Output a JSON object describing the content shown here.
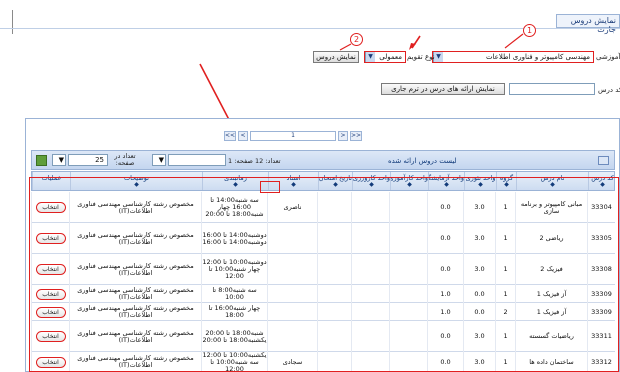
{
  "top": {
    "tab_label": "نمایش دروس جارت",
    "group_label": "گروه آموزشی",
    "group_value": "مهندسی کامپیوتر و فناوری اطلاعات",
    "type_label": "نوع تقویم",
    "type_value": "معمولی",
    "show_button": "نمایش دروس",
    "course_label": "کد درس",
    "offered_button": "نمایش ارائه های درس در ترم جاری",
    "marker_1": "1",
    "marker_2": "2"
  },
  "pager": {
    "first": "<<",
    "prev": "<",
    "current": "1",
    "next": ">",
    "last": ">>"
  },
  "table": {
    "title": "لیست دروس ارائه شده",
    "count_label": "تعداد: 12 صفحه: 1",
    "per_page_label": "تعداد در صفحه:",
    "per_page_value": "25",
    "columns": [
      "کد درس",
      "نام درس",
      "گروه",
      "واحد تئوری",
      "واحد آزمایشگاه",
      "واحد کارآموزی",
      "واحد کارورزی",
      "تاریخ امتحان",
      "استاد",
      "زمانبندی",
      "توضیحات",
      "عملیات"
    ],
    "rows": [
      {
        "code": "33304",
        "name": "مبانی کامپیوتر و برنامه سازی",
        "group": "1",
        "theory": "3.0",
        "lab": "0.0",
        "instructor": "ناصری",
        "schedule": "سه شنبه14:00 تا 16:00 چهار شنبه18:00 تا 20:00",
        "notes": "مخصوص رشته کارشناسی مهندسی فناوری اطلاعات(IT)",
        "action": "انتخاب"
      },
      {
        "code": "33305",
        "name": "ریاضی 2",
        "group": "1",
        "theory": "3.0",
        "lab": "0.0",
        "instructor": "",
        "schedule": "دوشنبه14:00 تا 16:00 دوشنبه14:00 تا 16:00",
        "notes": "مخصوص رشته کارشناسی مهندسی فناوری اطلاعات(IT)",
        "action": "انتخاب"
      },
      {
        "code": "33308",
        "name": "فیزیک 2",
        "group": "1",
        "theory": "3.0",
        "lab": "0.0",
        "instructor": "",
        "schedule": "دوشنبه10:00 تا 12:00 چهار شنبه10:00 تا 12:00",
        "notes": "مخصوص رشته کارشناسی مهندسی فناوری اطلاعات(IT)",
        "action": "انتخاب"
      },
      {
        "code": "33309",
        "name": "آز فیزیک 1",
        "group": "1",
        "theory": "0.0",
        "lab": "1.0",
        "instructor": "",
        "schedule": "سه شنبه8:00 تا 10:00",
        "notes": "مخصوص رشته کارشناسی مهندسی فناوری اطلاعات(IT)",
        "action": "انتخاب"
      },
      {
        "code": "33309",
        "name": "آز فیزیک 1",
        "group": "2",
        "theory": "0.0",
        "lab": "1.0",
        "instructor": "",
        "schedule": "چهار شنبه16:00 تا 18:00",
        "notes": "مخصوص رشته کارشناسی مهندسی فناوری اطلاعات(IT)",
        "action": "انتخاب"
      },
      {
        "code": "33311",
        "name": "ریاضیات گسسته",
        "group": "1",
        "theory": "3.0",
        "lab": "0.0",
        "instructor": "",
        "schedule": "شنبه18:00 تا 20:00 یکشنبه18:00 تا 20:00",
        "notes": "مخصوص رشته کارشناسی مهندسی فناوری اطلاعات(IT)",
        "action": "انتخاب"
      },
      {
        "code": "33312",
        "name": "ساختمان داده ها",
        "group": "1",
        "theory": "3.0",
        "lab": "0.0",
        "instructor": "سجادی",
        "schedule": "یکشنبه10:00 تا 12:00 سه شنبه10:00 تا 12:00",
        "notes": "مخصوص رشته کارشناسی مهندسی فناوری اطلاعات(IT)",
        "action": "انتخاب"
      }
    ]
  },
  "colors": {
    "annotation": "#e02020",
    "header_blue": "#123b7a",
    "border": "#9bb3d6"
  },
  "icons": {
    "grid": "grid-icon",
    "refresh": "refresh-icon"
  }
}
